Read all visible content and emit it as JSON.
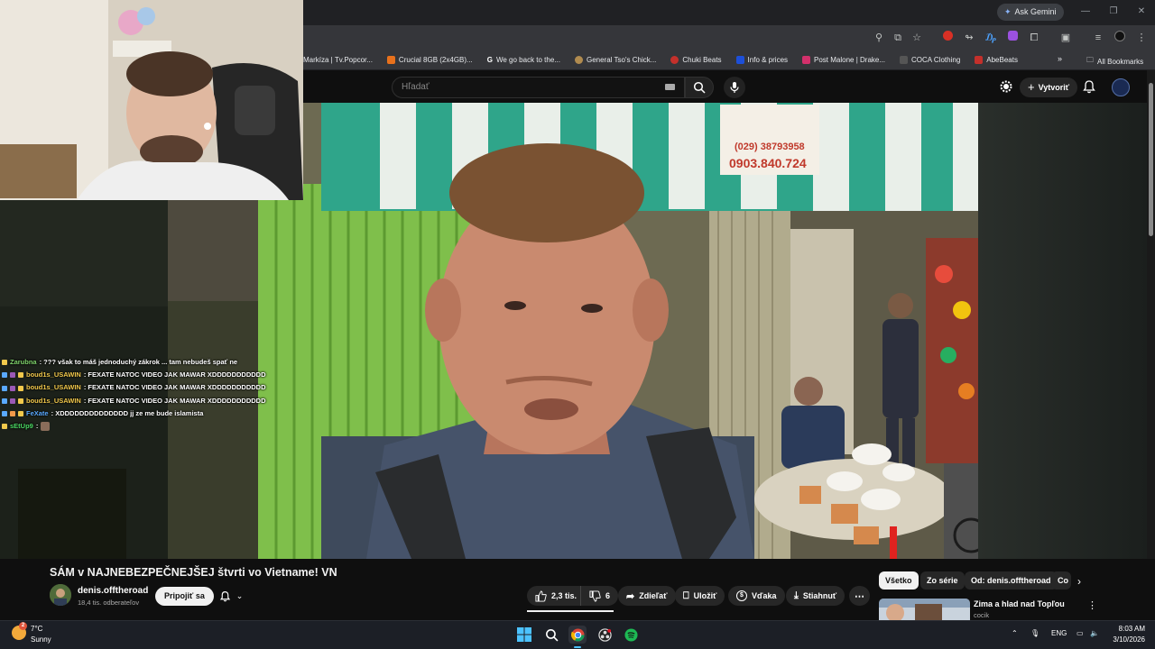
{
  "browser": {
    "ask_gemini": "Ask Gemini",
    "bookmarks": [
      {
        "label": "Markíza | Tv.Popcor...",
        "color": "#3d7bd9"
      },
      {
        "label": "Crucial 8GB (2x4GB)...",
        "color": "#e8711c"
      },
      {
        "label": "We go back to the...",
        "color": "#4285f4"
      },
      {
        "label": "General Tso's Chick...",
        "color": "#b08b4f"
      },
      {
        "label": "Chuki Beats",
        "color": "#c4302b"
      },
      {
        "label": "Info & prices",
        "color": "#1d4fd8"
      },
      {
        "label": "Post Malone | Drake...",
        "color": "#d2306b"
      },
      {
        "label": "COCA Clothing",
        "color": "#222222"
      },
      {
        "label": "AbeBeats",
        "color": "#c4302b"
      }
    ],
    "all_bookmarks": "All Bookmarks"
  },
  "youtube": {
    "search_placeholder": "Hľadať",
    "create_label": "Vytvoriť"
  },
  "chat": [
    {
      "user": "Zarubna",
      "user_color": "#7fd36b",
      "message": ": ??? však to máš jednoduchý zákrok ... tam nebudeš spať ne"
    },
    {
      "user": "boud1s_USAWIN",
      "user_color": "#f2c94c",
      "message": ": FEXATE NATOC VIDEO JAK MAWAR XDDDDDDDDDDD"
    },
    {
      "user": "boud1s_USAWIN",
      "user_color": "#f2c94c",
      "message": ": FEXATE NATOC VIDEO JAK MAWAR XDDDDDDDDDDD"
    },
    {
      "user": "boud1s_USAWIN",
      "user_color": "#f2c94c",
      "message": ": FEXATE NATOC VIDEO JAK MAWAR XDDDDDDDDDDD"
    },
    {
      "user": "FeXate",
      "user_color": "#5aa9ff",
      "message": ": XDDDDDDDDDDDDDD jj ze me bude islamista"
    },
    {
      "user": "sEtUp9",
      "user_color": "#4cd964",
      "message": ":"
    }
  ],
  "video": {
    "title": "SÁM v NAJNEBEZPEČNEJŠEJ štvrti vo Vietname! 🇻🇳",
    "title_text": "SÁM v NAJNEBEZPEČNEJŠEJ štvrti vo Vietname! VN",
    "channel": "denis.offtheroad",
    "subscribers": "18,4 tis. odberateľov",
    "join_label": "Pripojiť sa",
    "likes": "2,3 tis.",
    "dislikes": "6",
    "share_label": "Zdieľať",
    "save_label": "Uložiť",
    "thanks_label": "Vďaka",
    "download_label": "Stiahnuť",
    "sign_phone": "(029) 38793958",
    "sign_mobile": "0903.840.724"
  },
  "sidebar": {
    "chips": [
      "Všetko",
      "Zo série",
      "Od: denis.offtheroad",
      "Co"
    ],
    "recommended": {
      "title": "Zima a hlad nad Topľou",
      "channel": "cocik"
    }
  },
  "taskbar": {
    "weather_temp": "7°C",
    "weather_cond": "Sunny",
    "weather_badge": "2",
    "lang": "ENG",
    "time": "8:03 AM",
    "date": "3/10/2026"
  }
}
